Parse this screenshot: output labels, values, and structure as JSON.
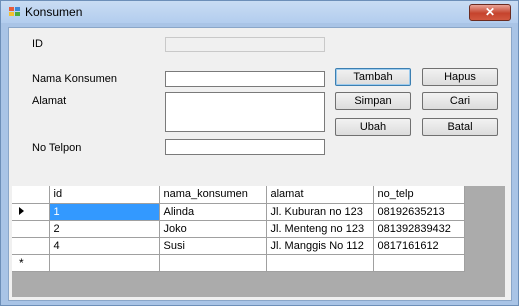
{
  "window": {
    "title": "Konsumen",
    "close_label": "✕"
  },
  "form": {
    "id_label": "ID",
    "nama_label": "Nama Konsumen",
    "alamat_label": "Alamat",
    "telp_label": "No Telpon",
    "id_value": "",
    "nama_value": "",
    "alamat_value": "",
    "telp_value": ""
  },
  "buttons": {
    "tambah": "Tambah",
    "hapus": "Hapus",
    "simpan": "Simpan",
    "cari": "Cari",
    "ubah": "Ubah",
    "batal": "Batal"
  },
  "grid": {
    "columns": [
      "id",
      "nama_konsumen",
      "alamat",
      "no_telp"
    ],
    "rows": [
      [
        "1",
        "Alinda",
        "Jl. Kuburan no 123",
        "08192635213"
      ],
      [
        "2",
        "Joko",
        "Jl. Menteng no 123",
        "081392839432"
      ],
      [
        "4",
        "Susi",
        "Jl. Manggis No 112",
        "0817161612"
      ]
    ],
    "new_row_marker": "*"
  },
  "colors": {
    "selection": "#3399ff",
    "close_button": "#c5432d"
  }
}
